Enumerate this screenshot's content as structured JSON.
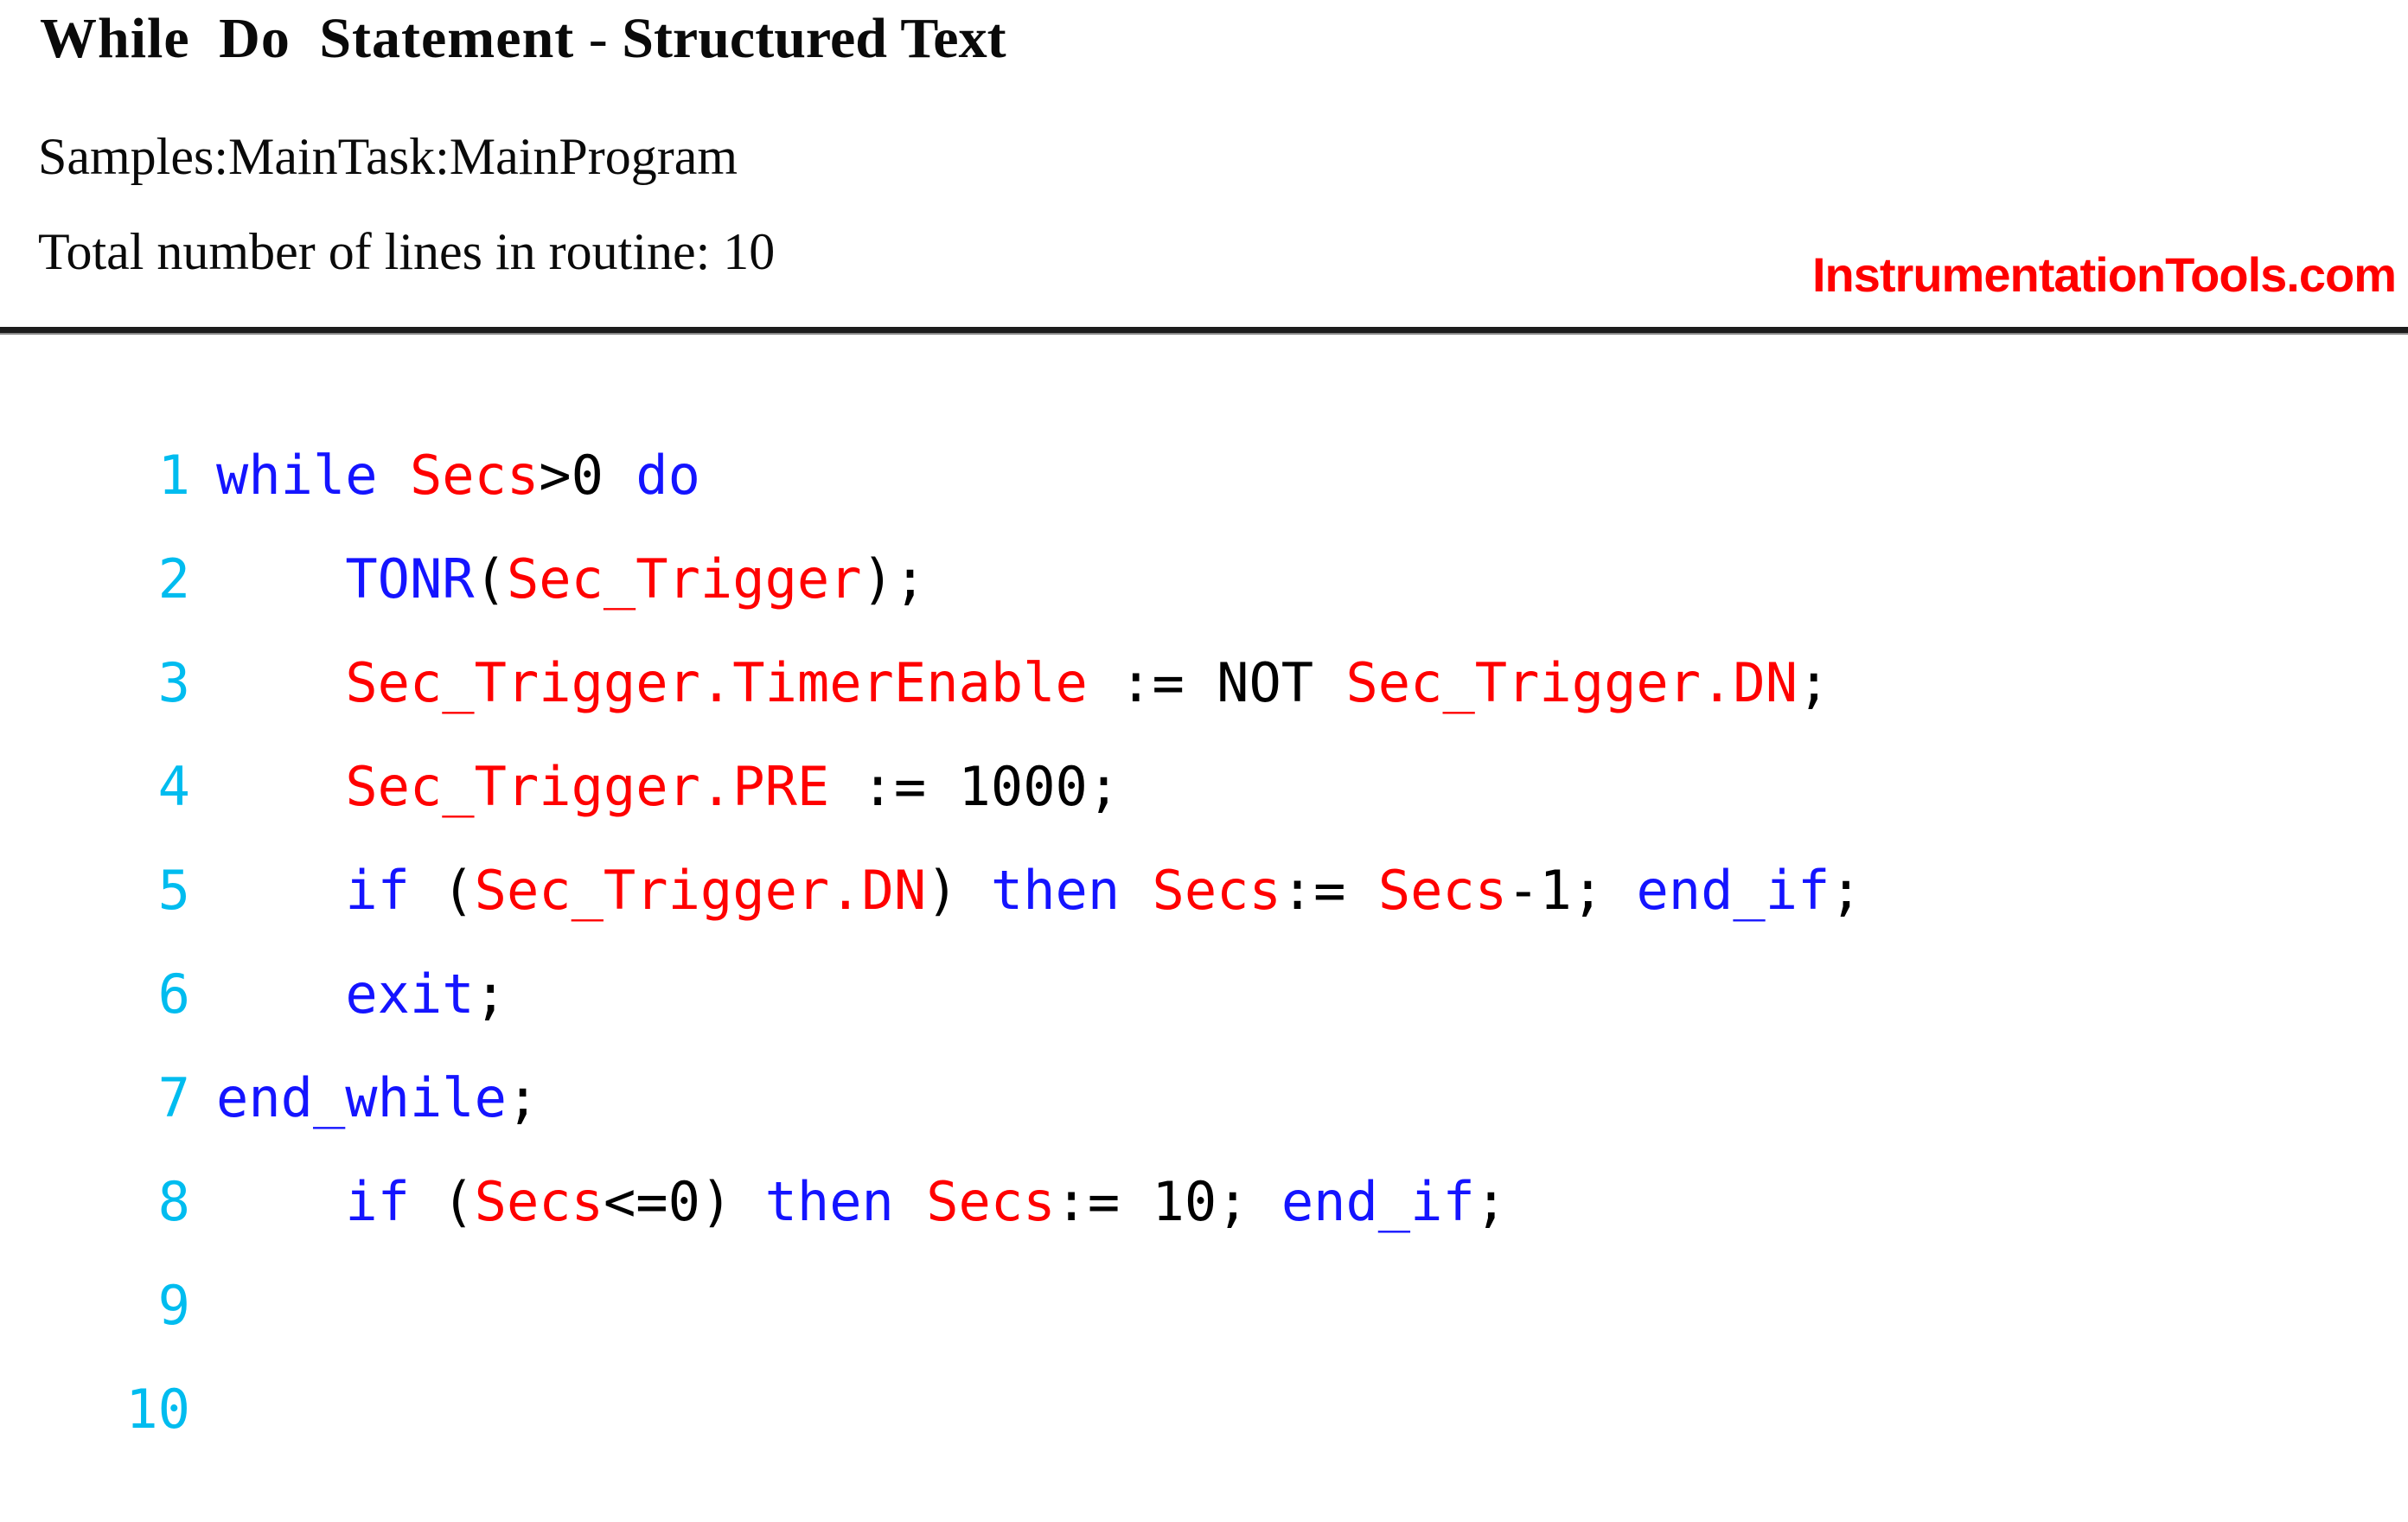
{
  "header": {
    "title_main": "While  Do  Statement",
    "title_separator": " - ",
    "title_sub": "Structured Text",
    "scope_path": "Samples:MainTask:MainProgram",
    "line_count_label": "Total number of lines in routine: 10",
    "watermark": "InstrumentationTools.com"
  },
  "colors": {
    "keyword": "#1414FF",
    "variable": "#FF0000",
    "operator": "#000000",
    "line_number": "#00BCEF",
    "watermark": "#FF0000",
    "rule": "#1C1C1C"
  },
  "code": {
    "total_lines": 10,
    "lines": [
      {
        "number": "1",
        "tokens": [
          {
            "t": "while ",
            "k": "kw"
          },
          {
            "t": "Secs",
            "k": "var"
          },
          {
            "t": ">0 ",
            "k": "op"
          },
          {
            "t": "do",
            "k": "kw"
          }
        ]
      },
      {
        "number": "2",
        "tokens": [
          {
            "t": "    ",
            "k": "op"
          },
          {
            "t": "TONR",
            "k": "kw"
          },
          {
            "t": "(",
            "k": "op"
          },
          {
            "t": "Sec_Trigger",
            "k": "var"
          },
          {
            "t": ");",
            "k": "op"
          }
        ]
      },
      {
        "number": "3",
        "tokens": [
          {
            "t": "    ",
            "k": "op"
          },
          {
            "t": "Sec_Trigger.TimerEnable",
            "k": "var"
          },
          {
            "t": " := NOT ",
            "k": "op"
          },
          {
            "t": "Sec_Trigger.DN",
            "k": "var"
          },
          {
            "t": ";",
            "k": "op"
          }
        ]
      },
      {
        "number": "4",
        "tokens": [
          {
            "t": "    ",
            "k": "op"
          },
          {
            "t": "Sec_Trigger.PRE",
            "k": "var"
          },
          {
            "t": " := 1000;",
            "k": "op"
          }
        ]
      },
      {
        "number": "5",
        "tokens": [
          {
            "t": "    ",
            "k": "op"
          },
          {
            "t": "if ",
            "k": "kw"
          },
          {
            "t": "(",
            "k": "op"
          },
          {
            "t": "Sec_Trigger.DN",
            "k": "var"
          },
          {
            "t": ") ",
            "k": "op"
          },
          {
            "t": "then ",
            "k": "kw"
          },
          {
            "t": "Secs",
            "k": "var"
          },
          {
            "t": ":= ",
            "k": "op"
          },
          {
            "t": "Secs",
            "k": "var"
          },
          {
            "t": "-1; ",
            "k": "op"
          },
          {
            "t": "end_if",
            "k": "kw"
          },
          {
            "t": ";",
            "k": "op"
          }
        ]
      },
      {
        "number": "6",
        "tokens": [
          {
            "t": "    ",
            "k": "op"
          },
          {
            "t": "exit",
            "k": "kw"
          },
          {
            "t": ";",
            "k": "op"
          }
        ]
      },
      {
        "number": "7",
        "tokens": [
          {
            "t": "end_while",
            "k": "kw"
          },
          {
            "t": ";",
            "k": "op"
          }
        ]
      },
      {
        "number": "8",
        "tokens": [
          {
            "t": "    ",
            "k": "op"
          },
          {
            "t": "if ",
            "k": "kw"
          },
          {
            "t": "(",
            "k": "op"
          },
          {
            "t": "Secs",
            "k": "var"
          },
          {
            "t": "<=0) ",
            "k": "op"
          },
          {
            "t": "then ",
            "k": "kw"
          },
          {
            "t": "Secs",
            "k": "var"
          },
          {
            "t": ":= 10; ",
            "k": "op"
          },
          {
            "t": "end_if",
            "k": "kw"
          },
          {
            "t": ";",
            "k": "op"
          }
        ]
      },
      {
        "number": "9",
        "tokens": []
      },
      {
        "number": "10",
        "tokens": []
      }
    ]
  }
}
